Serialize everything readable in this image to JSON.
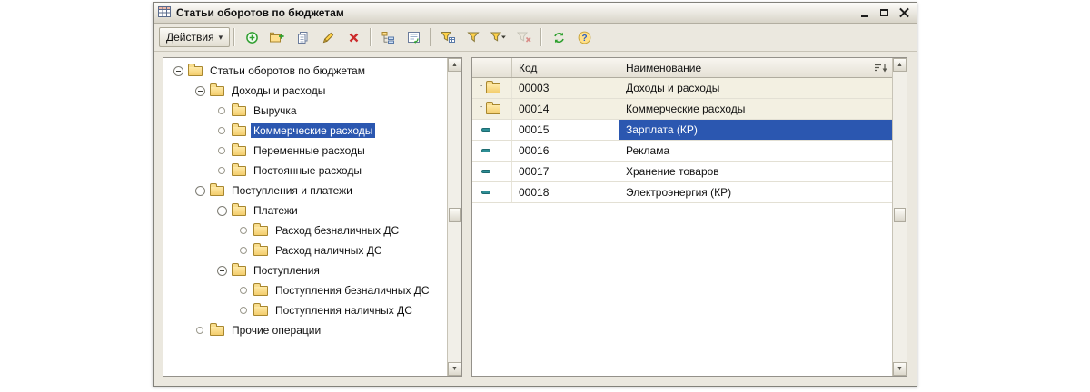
{
  "window": {
    "title": "Статьи оборотов по бюджетам",
    "title_icon": "table-icon",
    "controls": [
      {
        "name": "minimize-button"
      },
      {
        "name": "maximize-button"
      },
      {
        "name": "close-button"
      }
    ]
  },
  "toolbar": {
    "actions_button": {
      "label": "Действия",
      "arrow": "▾"
    },
    "icon_buttons": [
      {
        "name": "add-button"
      },
      {
        "name": "add-group-button"
      },
      {
        "name": "copy-button"
      },
      {
        "name": "edit-button"
      },
      {
        "name": "delete-button"
      },
      {
        "name": "hierarchy-view-button"
      },
      {
        "name": "move-to-group-button"
      },
      {
        "name": "filter-settings-button"
      },
      {
        "name": "filter-by-value-button"
      },
      {
        "name": "filter-history-button"
      },
      {
        "name": "clear-filter-button",
        "disabled": true
      },
      {
        "name": "refresh-button"
      },
      {
        "name": "help-button"
      }
    ]
  },
  "icons": {
    "help_glyph": "?",
    "scroll_up": "▲",
    "scroll_down": "▼",
    "group_marker": "↑"
  },
  "tree": {
    "items": [
      {
        "label": "Статьи оборотов по бюджетам",
        "level": 0,
        "node": "expanded",
        "selected": false
      },
      {
        "label": "Доходы и расходы",
        "level": 1,
        "node": "expanded",
        "selected": false
      },
      {
        "label": "Выручка",
        "level": 2,
        "node": "leaf",
        "selected": false
      },
      {
        "label": "Коммерческие расходы",
        "level": 2,
        "node": "leaf",
        "selected": true
      },
      {
        "label": "Переменные расходы",
        "level": 2,
        "node": "leaf",
        "selected": false
      },
      {
        "label": "Постоянные расходы",
        "level": 2,
        "node": "leaf",
        "selected": false
      },
      {
        "label": "Поступления и платежи",
        "level": 1,
        "node": "expanded",
        "selected": false
      },
      {
        "label": "Платежи",
        "level": 2,
        "node": "expanded",
        "selected": false
      },
      {
        "label": "Расход безналичных ДС",
        "level": 3,
        "node": "leaf",
        "selected": false
      },
      {
        "label": "Расход наличных ДС",
        "level": 3,
        "node": "leaf",
        "selected": false
      },
      {
        "label": "Поступления",
        "level": 2,
        "node": "expanded",
        "selected": false
      },
      {
        "label": "Поступления безналичных ДС",
        "level": 3,
        "node": "leaf",
        "selected": false
      },
      {
        "label": "Поступления наличных ДС",
        "level": 3,
        "node": "leaf",
        "selected": false
      },
      {
        "label": "Прочие операции",
        "level": 1,
        "node": "leaf",
        "selected": false
      }
    ]
  },
  "table": {
    "columns": {
      "code": "Код",
      "name": "Наименование"
    },
    "rows": [
      {
        "type": "group",
        "code": "00003",
        "name": "Доходы и расходы",
        "selected": false
      },
      {
        "type": "group",
        "code": "00014",
        "name": "Коммерческие расходы",
        "selected": false
      },
      {
        "type": "item",
        "code": "00015",
        "name": "Зарплата (КР)",
        "selected": true
      },
      {
        "type": "item",
        "code": "00016",
        "name": "Реклама",
        "selected": false
      },
      {
        "type": "item",
        "code": "00017",
        "name": "Хранение товаров",
        "selected": false
      },
      {
        "type": "item",
        "code": "00018",
        "name": "Электроэнергия (КР)",
        "selected": false
      }
    ]
  },
  "colors": {
    "selection": "#2b57b0",
    "group_row_bg": "#f3f0e2",
    "window_bg": "#ebe8df",
    "folder": "#f3cd6d"
  }
}
